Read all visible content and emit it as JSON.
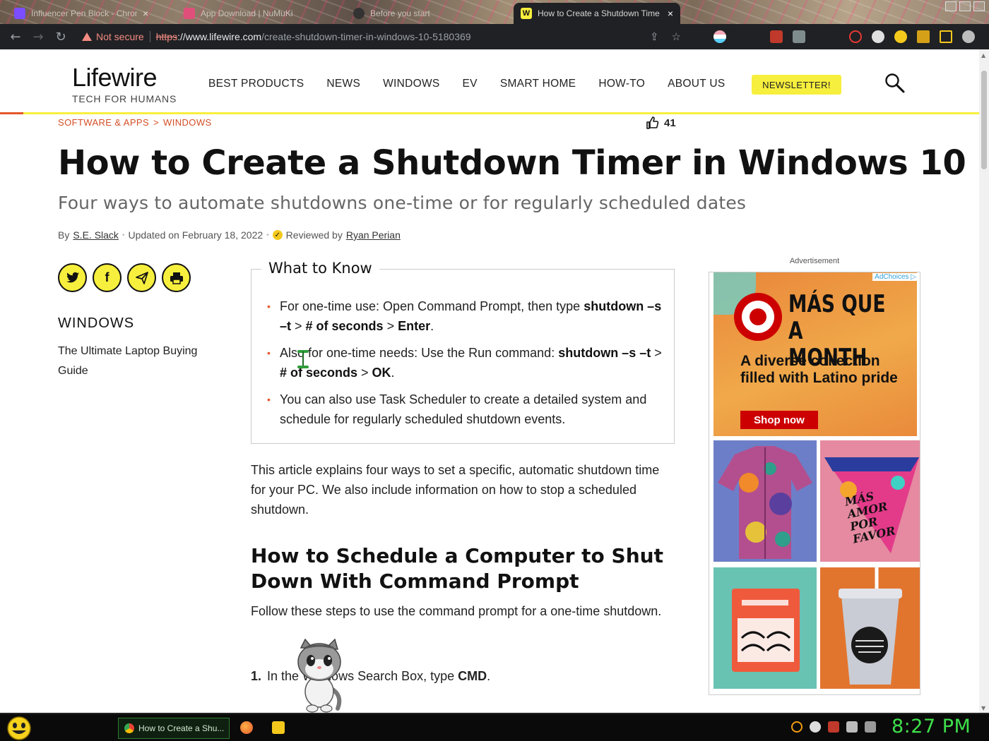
{
  "browser": {
    "tabs": [
      {
        "title": "Influencer Pen Block - Chrome",
        "active": false
      },
      {
        "title": "App Download | NuMuKi",
        "active": false
      },
      {
        "title": "Before you start",
        "active": false
      },
      {
        "title": "How to Create a Shutdown Time",
        "active": true
      }
    ],
    "security_label": "Not secure",
    "url_scheme": "https",
    "url_host": "://www.lifewire.com",
    "url_path": "/create-shutdown-timer-in-windows-10-5180369"
  },
  "site": {
    "logo_word": "Lifewire",
    "logo_tagline": "TECH FOR HUMANS",
    "nav": [
      "BEST PRODUCTS",
      "NEWS",
      "WINDOWS",
      "EV",
      "SMART HOME",
      "HOW-TO",
      "ABOUT US"
    ],
    "newsletter_label": "NEWSLETTER!"
  },
  "article": {
    "breadcrumb": [
      "SOFTWARE & APPS",
      ">",
      "WINDOWS"
    ],
    "likes": "41",
    "title": "How to Create a Shutdown Timer in Windows 10",
    "subtitle": "Four ways to automate shutdowns one-time or for regularly scheduled dates",
    "byline": {
      "by": "By",
      "author": "S.E. Slack",
      "updated": "Updated on February 18, 2022",
      "reviewed_by": "Reviewed by",
      "reviewer": "Ryan Perian"
    },
    "what_to_know": {
      "title": "What to Know",
      "items": [
        {
          "pre": "For one-time use: Open Command Prompt, then type ",
          "bold1": "shutdown –s –t",
          "mid1": " > ",
          "bold2": "# of seconds",
          "mid2": " > ",
          "bold3": "Enter",
          "post": "."
        },
        {
          "pre": "Also for one-time needs: Use the Run command: ",
          "bold1": "shutdown –s –t",
          "mid1": " > ",
          "bold2": "# of seconds",
          "mid2": " > ",
          "bold3": "OK",
          "post": "."
        },
        {
          "pre": "You can also use Task Scheduler to create a detailed system and schedule for regularly scheduled shutdown events.",
          "bold1": "",
          "mid1": "",
          "bold2": "",
          "mid2": "",
          "bold3": "",
          "post": ""
        }
      ]
    },
    "intro": "This article explains four ways to set a specific, automatic shutdown time for your PC. We also include information on how to stop a scheduled shutdown.",
    "section_heading": "How to Schedule a Computer to Shut Down With Command Prompt",
    "section_intro": "Follow these steps to use the command prompt for a one-time shutdown.",
    "step1": {
      "num": "1.",
      "text": "In the Windows Search Box, type ",
      "bold": "CMD",
      "post": "."
    }
  },
  "sidebar": {
    "heading": "WINDOWS",
    "link": "The Ultimate Laptop Buying Guide"
  },
  "ad": {
    "label": "Advertisement",
    "adchoices": "AdChoices",
    "headline": "MÁS QUE A MONTH",
    "sub": "A diverse collection filled with Latino pride",
    "cta": "Shop now",
    "tile_lettering": "MÁS AMOR POR FAVOR"
  },
  "taskbar": {
    "task_label": "How to Create a Shu...",
    "clock": "8:27 PM"
  },
  "colors": {
    "accent_yellow": "#f7ef3d",
    "accent_orange": "#e5572b",
    "clock_green": "#3ee04a"
  }
}
